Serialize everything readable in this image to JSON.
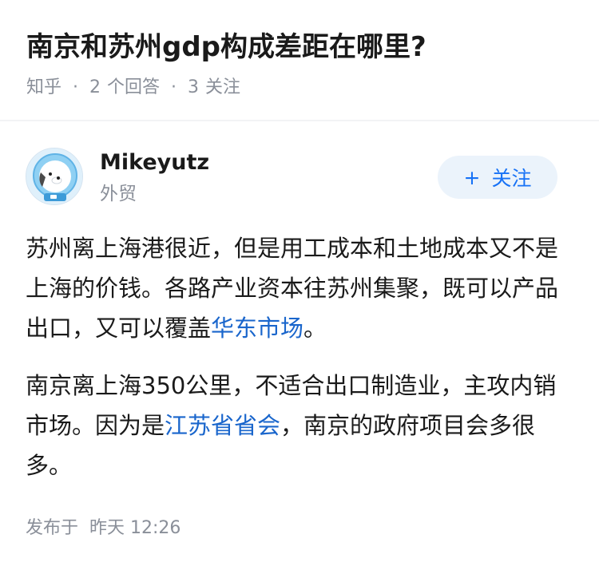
{
  "question": {
    "title": "南京和苏州gdp构成差距在哪里?",
    "source": "知乎",
    "answer_count": "2",
    "answer_label": "个回答",
    "follow_count": "3",
    "follow_label": "关注",
    "separator": "·"
  },
  "author": {
    "name": "Mikeyutz",
    "bio": "外贸",
    "avatar_icon": "dog-astronaut-avatar",
    "follow_button": {
      "icon": "+",
      "label": "关注"
    }
  },
  "answer": {
    "p1": {
      "text_before": "苏州离上海港很近，但是用工成本和土地成本又不是上海的价钱。各路产业资本往苏州集聚，既可以产品出口，又可以覆盖",
      "link": "华东市场",
      "text_after": "。"
    },
    "p2": {
      "text_before": "南京离上海350公里，不适合出口制造业，主攻内销市场。因为是",
      "link": "江苏省省会",
      "text_after": "，南京的政府项目会多很多。"
    }
  },
  "published": {
    "label": "发布于",
    "time": "昨天 12:26"
  },
  "colors": {
    "accent": "#1772f6",
    "link": "#1a66cc",
    "muted": "#8a8f99",
    "follow_bg": "#ebf3fb"
  }
}
